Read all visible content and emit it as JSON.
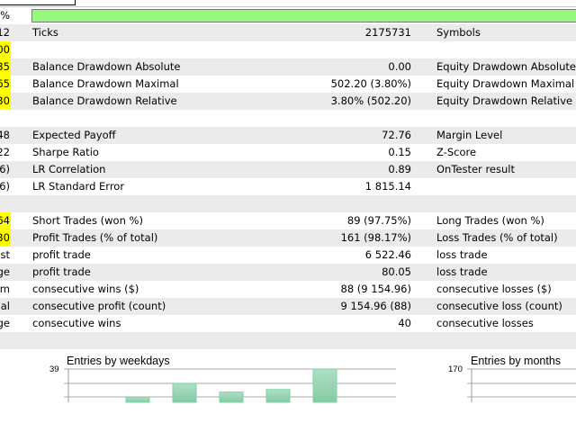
{
  "progress": {
    "left_fragment": "%",
    "percent": 100,
    "color": "#98f77f"
  },
  "rows": [
    {
      "left": "12",
      "label": "Ticks",
      "value": "2175731",
      "right_label": "Symbols",
      "highlight": false
    },
    {
      "left": "00",
      "label": "",
      "value": "",
      "right_label": "",
      "highlight": true
    },
    {
      "left": "35",
      "label": "Balance Drawdown Absolute",
      "value": "0.00",
      "right_label": "Equity Drawdown Absolute",
      "highlight": true
    },
    {
      "left": "65",
      "label": "Balance Drawdown Maximal",
      "value": "502.20 (3.80%)",
      "right_label": "Equity Drawdown Maximal",
      "highlight": true
    },
    {
      "left": "30",
      "label": "Balance Drawdown Relative",
      "value": "3.80% (502.20)",
      "right_label": "Equity Drawdown Relative",
      "highlight": true
    },
    {
      "left": "",
      "label": "",
      "value": "",
      "right_label": "",
      "highlight": false
    },
    {
      "left": "48",
      "label": "Expected Payoff",
      "value": "72.76",
      "right_label": "Margin Level",
      "highlight": false
    },
    {
      "left": "22",
      "label": "Sharpe Ratio",
      "value": "0.15",
      "right_label": "Z-Score",
      "highlight": false
    },
    {
      "left": "6)",
      "label": "LR Correlation",
      "value": "0.89",
      "right_label": "OnTester result",
      "highlight": false
    },
    {
      "left": "6)",
      "label": "LR Standard Error",
      "value": "1 815.14",
      "right_label": "",
      "highlight": false
    },
    {
      "left": "",
      "label": "",
      "value": "",
      "right_label": "",
      "highlight": false
    },
    {
      "left": "64",
      "label": "Short Trades (won %)",
      "value": "89 (97.75%)",
      "right_label": "Long Trades (won %)",
      "highlight": true
    },
    {
      "left": "30",
      "label": "Profit Trades (% of total)",
      "value": "161 (98.17%)",
      "right_label": "Loss Trades (% of total)",
      "highlight": true
    },
    {
      "left": "st",
      "label": "profit trade",
      "value": "6 522.46",
      "right_label": "loss trade",
      "highlight": false
    },
    {
      "left": "ge",
      "label": "profit trade",
      "value": "80.05",
      "right_label": "loss trade",
      "highlight": false
    },
    {
      "left": "m",
      "label": "consecutive wins ($)",
      "value": "88 (9 154.96)",
      "right_label": "consecutive losses ($)",
      "highlight": false
    },
    {
      "left": "al",
      "label": "consecutive profit (count)",
      "value": "9 154.96 (88)",
      "right_label": "consecutive loss (count)",
      "highlight": false
    },
    {
      "left": "ge",
      "label": "consecutive wins",
      "value": "40",
      "right_label": "consecutive losses",
      "highlight": false
    },
    {
      "left": "",
      "label": "",
      "value": "",
      "right_label": "",
      "highlight": false
    }
  ],
  "chart_data": [
    {
      "type": "bar",
      "title": "Entries by weekdays",
      "ylim": [
        0,
        39
      ],
      "ytick_label": "39",
      "values": [
        0,
        6,
        22,
        12,
        15,
        39
      ],
      "bar_color": "#8fd1ad",
      "grid": true
    },
    {
      "type": "bar",
      "title": "Entries by months",
      "ylim": [
        0,
        170
      ],
      "ytick_label": "170",
      "values": [],
      "grid": true
    }
  ]
}
